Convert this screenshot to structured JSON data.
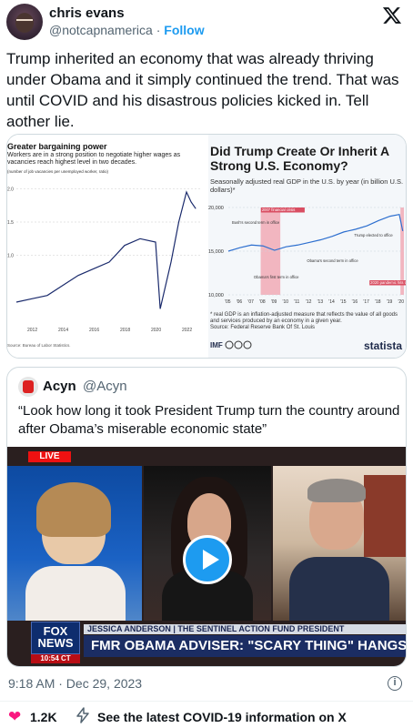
{
  "author": {
    "name": "chris evans",
    "handle": "@notcapnamerica",
    "separator": "·",
    "follow_label": "Follow"
  },
  "icons": {
    "x_logo": "x-logo-icon",
    "info": "info-icon",
    "heart": "heart-icon",
    "bolt": "bolt-icon",
    "play": "play-icon"
  },
  "tweet": {
    "text": "Trump inherited an economy that was already thriving under Obama and it simply continued the trend. That was until COVID and his disastrous policies kicked in. Tell aother lie.",
    "timestamp": "9:18 AM · Dec 29, 2023"
  },
  "media": {
    "left_chart": {
      "title": "Greater bargaining power",
      "subtitle": "Workers are in a strong position to negotiate higher wages as vacancies reach highest level in two decades.",
      "unit": "(number of job vacancies per unemployed worker, ratio)",
      "source": "Source: Bureau of Labor Statistics."
    },
    "right_chart": {
      "title": "Did Trump Create Or Inherit A Strong U.S. Economy?",
      "subtitle": "Seasonally adjusted real GDP in the U.S. by year (in billion U.S. dollars)*",
      "footnote": "* real GDP is an inflation-adjusted measure that reflects the value of all goods and services produced by an economy in a given year.",
      "source": "Source: Federal Reserve Bank Of St. Louis",
      "brand": "statista",
      "imf": "IMF",
      "annotations": [
        "2007 financial crisis",
        "Bush's second term in office",
        "Trump elected to office",
        "Obama's second term in office",
        "Obama's first term in office",
        "2020 pandemic hits U.S. economy"
      ]
    }
  },
  "chart_data": [
    {
      "type": "line",
      "title": "Greater bargaining power",
      "ylabel": "(number of job vacancies per unemployed worker, ratio)",
      "x_ticks": [
        "2012",
        "2014",
        "2016",
        "2018",
        "2020",
        "2022"
      ],
      "y_ticks": [
        "1.0",
        "1.5",
        "2.0"
      ],
      "ylim": [
        0,
        2.1
      ],
      "x": [
        2011,
        2012,
        2013,
        2014,
        2015,
        2016,
        2017,
        2018,
        2019,
        2020.0,
        2020.3,
        2020.6,
        2021,
        2021.5,
        2022,
        2022.3,
        2022.6
      ],
      "values": [
        0.3,
        0.35,
        0.4,
        0.55,
        0.7,
        0.8,
        0.9,
        1.15,
        1.25,
        1.2,
        0.2,
        0.5,
        0.9,
        1.5,
        1.95,
        1.8,
        1.7
      ]
    },
    {
      "type": "line",
      "title": "Did Trump Create Or Inherit A Strong U.S. Economy?",
      "ylabel": "Seasonally adjusted real GDP in the U.S. by year (in billion U.S. dollars)*",
      "x_ticks": [
        "'05",
        "'06",
        "'07",
        "'08",
        "'09",
        "'10",
        "'11",
        "'12",
        "'13",
        "'14",
        "'15",
        "'16",
        "'17",
        "'18",
        "'19",
        "'20"
      ],
      "y_ticks": [
        "20,000",
        "15,000",
        "10,000"
      ],
      "ylim": [
        10000,
        20000
      ],
      "x": [
        2005,
        2006,
        2007,
        2008,
        2009,
        2010,
        2011,
        2012,
        2013,
        2014,
        2015,
        2016,
        2017,
        2018,
        2019,
        2019.8,
        2020.1
      ],
      "values": [
        15000,
        15400,
        15700,
        15600,
        15100,
        15500,
        15700,
        16000,
        16300,
        16700,
        17200,
        17500,
        17900,
        18500,
        19000,
        19200,
        17300
      ]
    }
  ],
  "quote": {
    "name": "Acyn",
    "handle": "@Acyn",
    "text": "“Look how long it took President Trump turn the country around after Obama’s miserable economic state”"
  },
  "video": {
    "live_label": "LIVE",
    "network_line1": "FOX",
    "network_line2": "NEWS",
    "clock": "10:54 CT",
    "lower_third_top": "JESSICA ANDERSON | THE SENTINEL ACTION FUND PRESIDENT",
    "lower_third_main": "FMR OBAMA ADVISER: \"SCARY THING\" HANGS OVER BIDEN"
  },
  "actions": {
    "likes": "1.2K",
    "covid_link": "See the latest COVID-19 information on X"
  },
  "colors": {
    "accent": "#1d9bf0",
    "like": "#f91880",
    "muted": "#536471",
    "text": "#0f1419"
  }
}
